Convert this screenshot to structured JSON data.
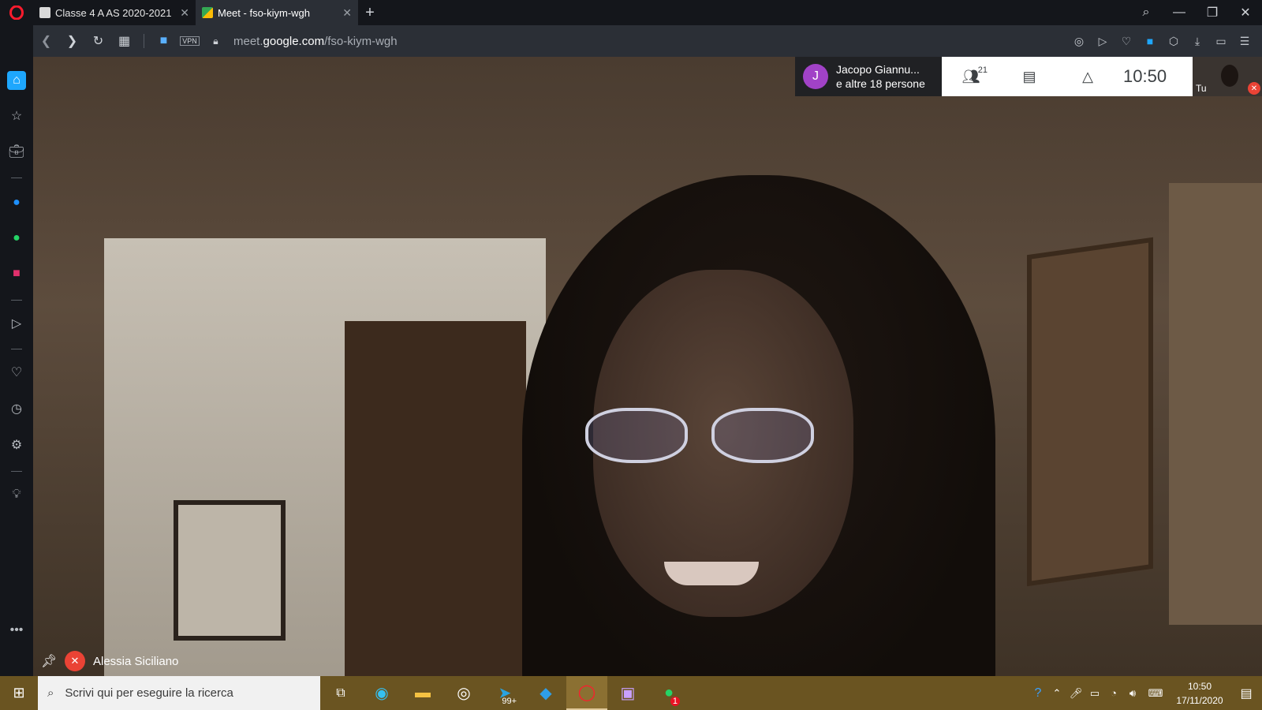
{
  "browser": {
    "tabs": [
      {
        "label": "Classe 4 A AS 2020-2021",
        "close": "✕"
      },
      {
        "label": "Meet - fso-kiym-wgh",
        "close": "✕"
      }
    ],
    "new_tab": "+",
    "url_prefix": "meet.",
    "url_domain": "google.com",
    "url_path": "/fso-kiym-wgh",
    "vpn_label": "VPN"
  },
  "meet": {
    "avatar_initial": "J",
    "participant_line1": "Jacopo Giannu...",
    "participant_line2": "e altre 18 persone",
    "participant_count": "21",
    "clock": "10:50",
    "self_label": "Tu",
    "speaker_name": "Alessia Siciliano"
  },
  "taskbar": {
    "search_placeholder": "Scrivi qui per eseguire la ricerca",
    "telegram_badge": "99+",
    "whatsapp_badge": "1",
    "time": "10:50",
    "date": "17/11/2020"
  }
}
